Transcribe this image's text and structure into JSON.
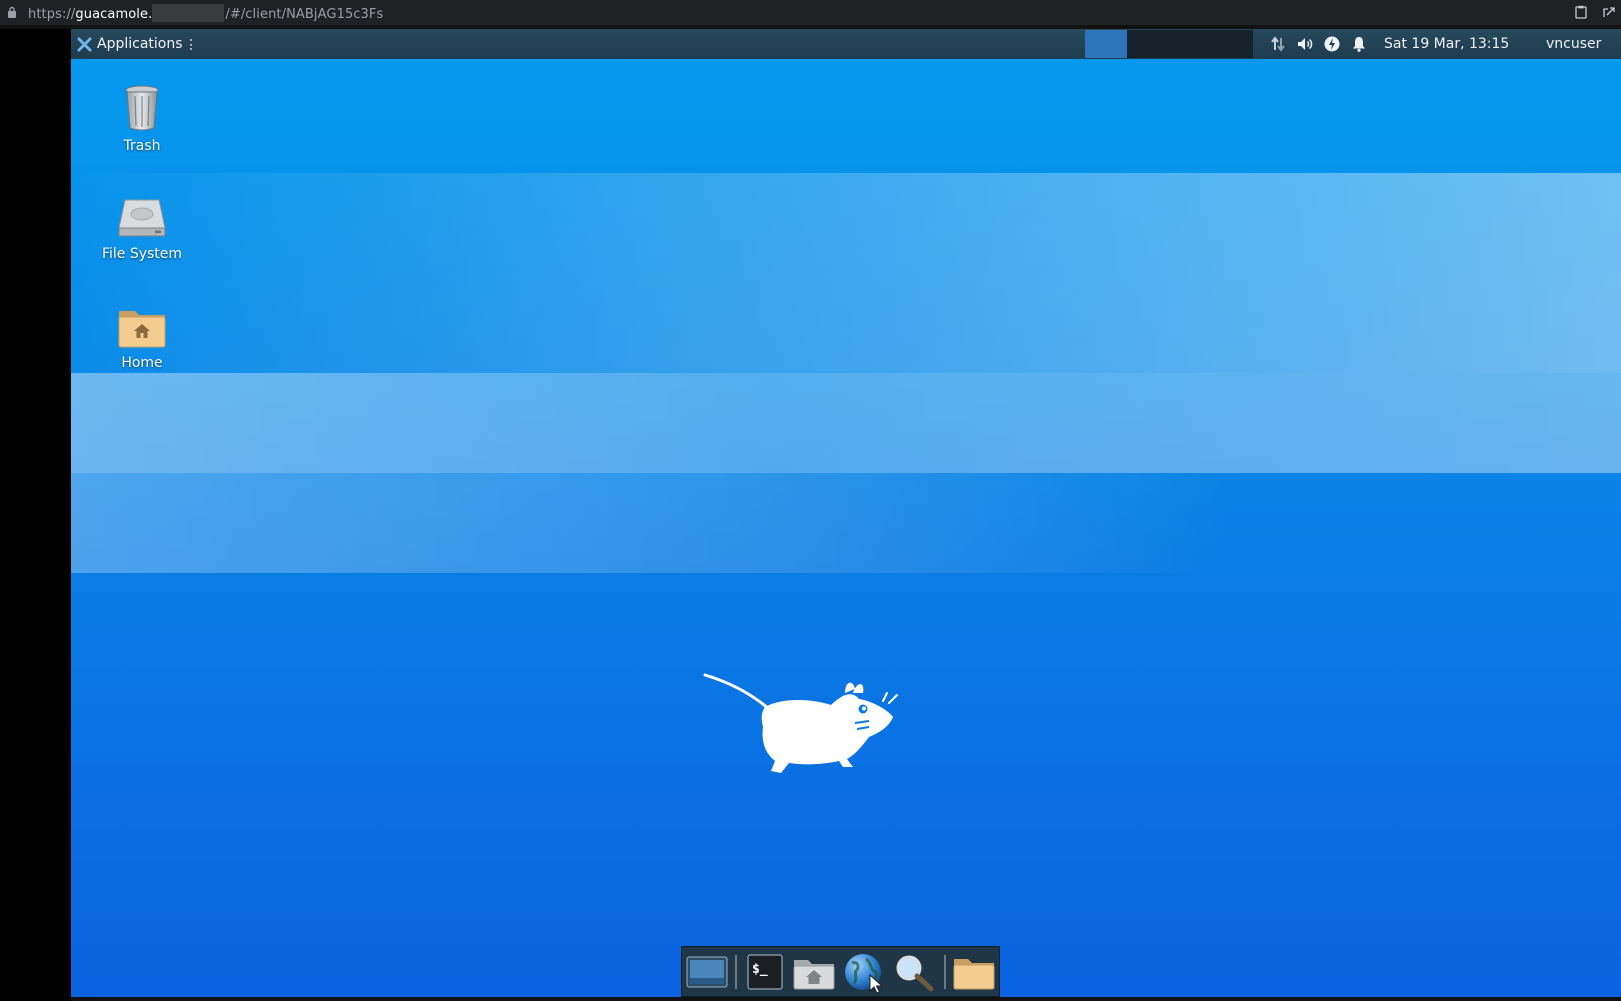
{
  "browser": {
    "url_scheme": "https://",
    "url_host": "guacamole.",
    "url_path": "/#/client/NABjAG15c3Fs"
  },
  "panel": {
    "applications_label": "Applications",
    "clock": "Sat 19 Mar, 13:15",
    "user": "vncuser",
    "tray_icons": [
      "network-icon",
      "volume-icon",
      "power-icon",
      "notification-bell-icon"
    ],
    "workspaces": [
      {
        "name": "workspace-1",
        "active": true
      },
      {
        "name": "workspace-2",
        "active": false
      },
      {
        "name": "workspace-3",
        "active": false
      },
      {
        "name": "workspace-4",
        "active": false
      }
    ]
  },
  "desktop_icons": [
    {
      "label": "Trash",
      "icon": "trash-icon"
    },
    {
      "label": "File System",
      "icon": "drive-icon"
    },
    {
      "label": "Home",
      "icon": "home-folder-icon"
    }
  ],
  "dock": {
    "items": [
      {
        "name": "show-desktop",
        "icon": "show-desktop-icon"
      },
      {
        "name": "terminal",
        "icon": "terminal-icon",
        "text": "$_"
      },
      {
        "name": "file-manager",
        "icon": "home-folder-icon"
      },
      {
        "name": "web-browser",
        "icon": "globe-icon"
      },
      {
        "name": "app-finder",
        "icon": "magnifier-icon"
      },
      {
        "name": "folder",
        "icon": "folder-icon"
      }
    ]
  },
  "colors": {
    "desktop_top": "#0499ee",
    "desktop_bottom": "#0a62e0",
    "panel_bg": "#1e3c4e",
    "active_workspace": "#2c74b9"
  }
}
